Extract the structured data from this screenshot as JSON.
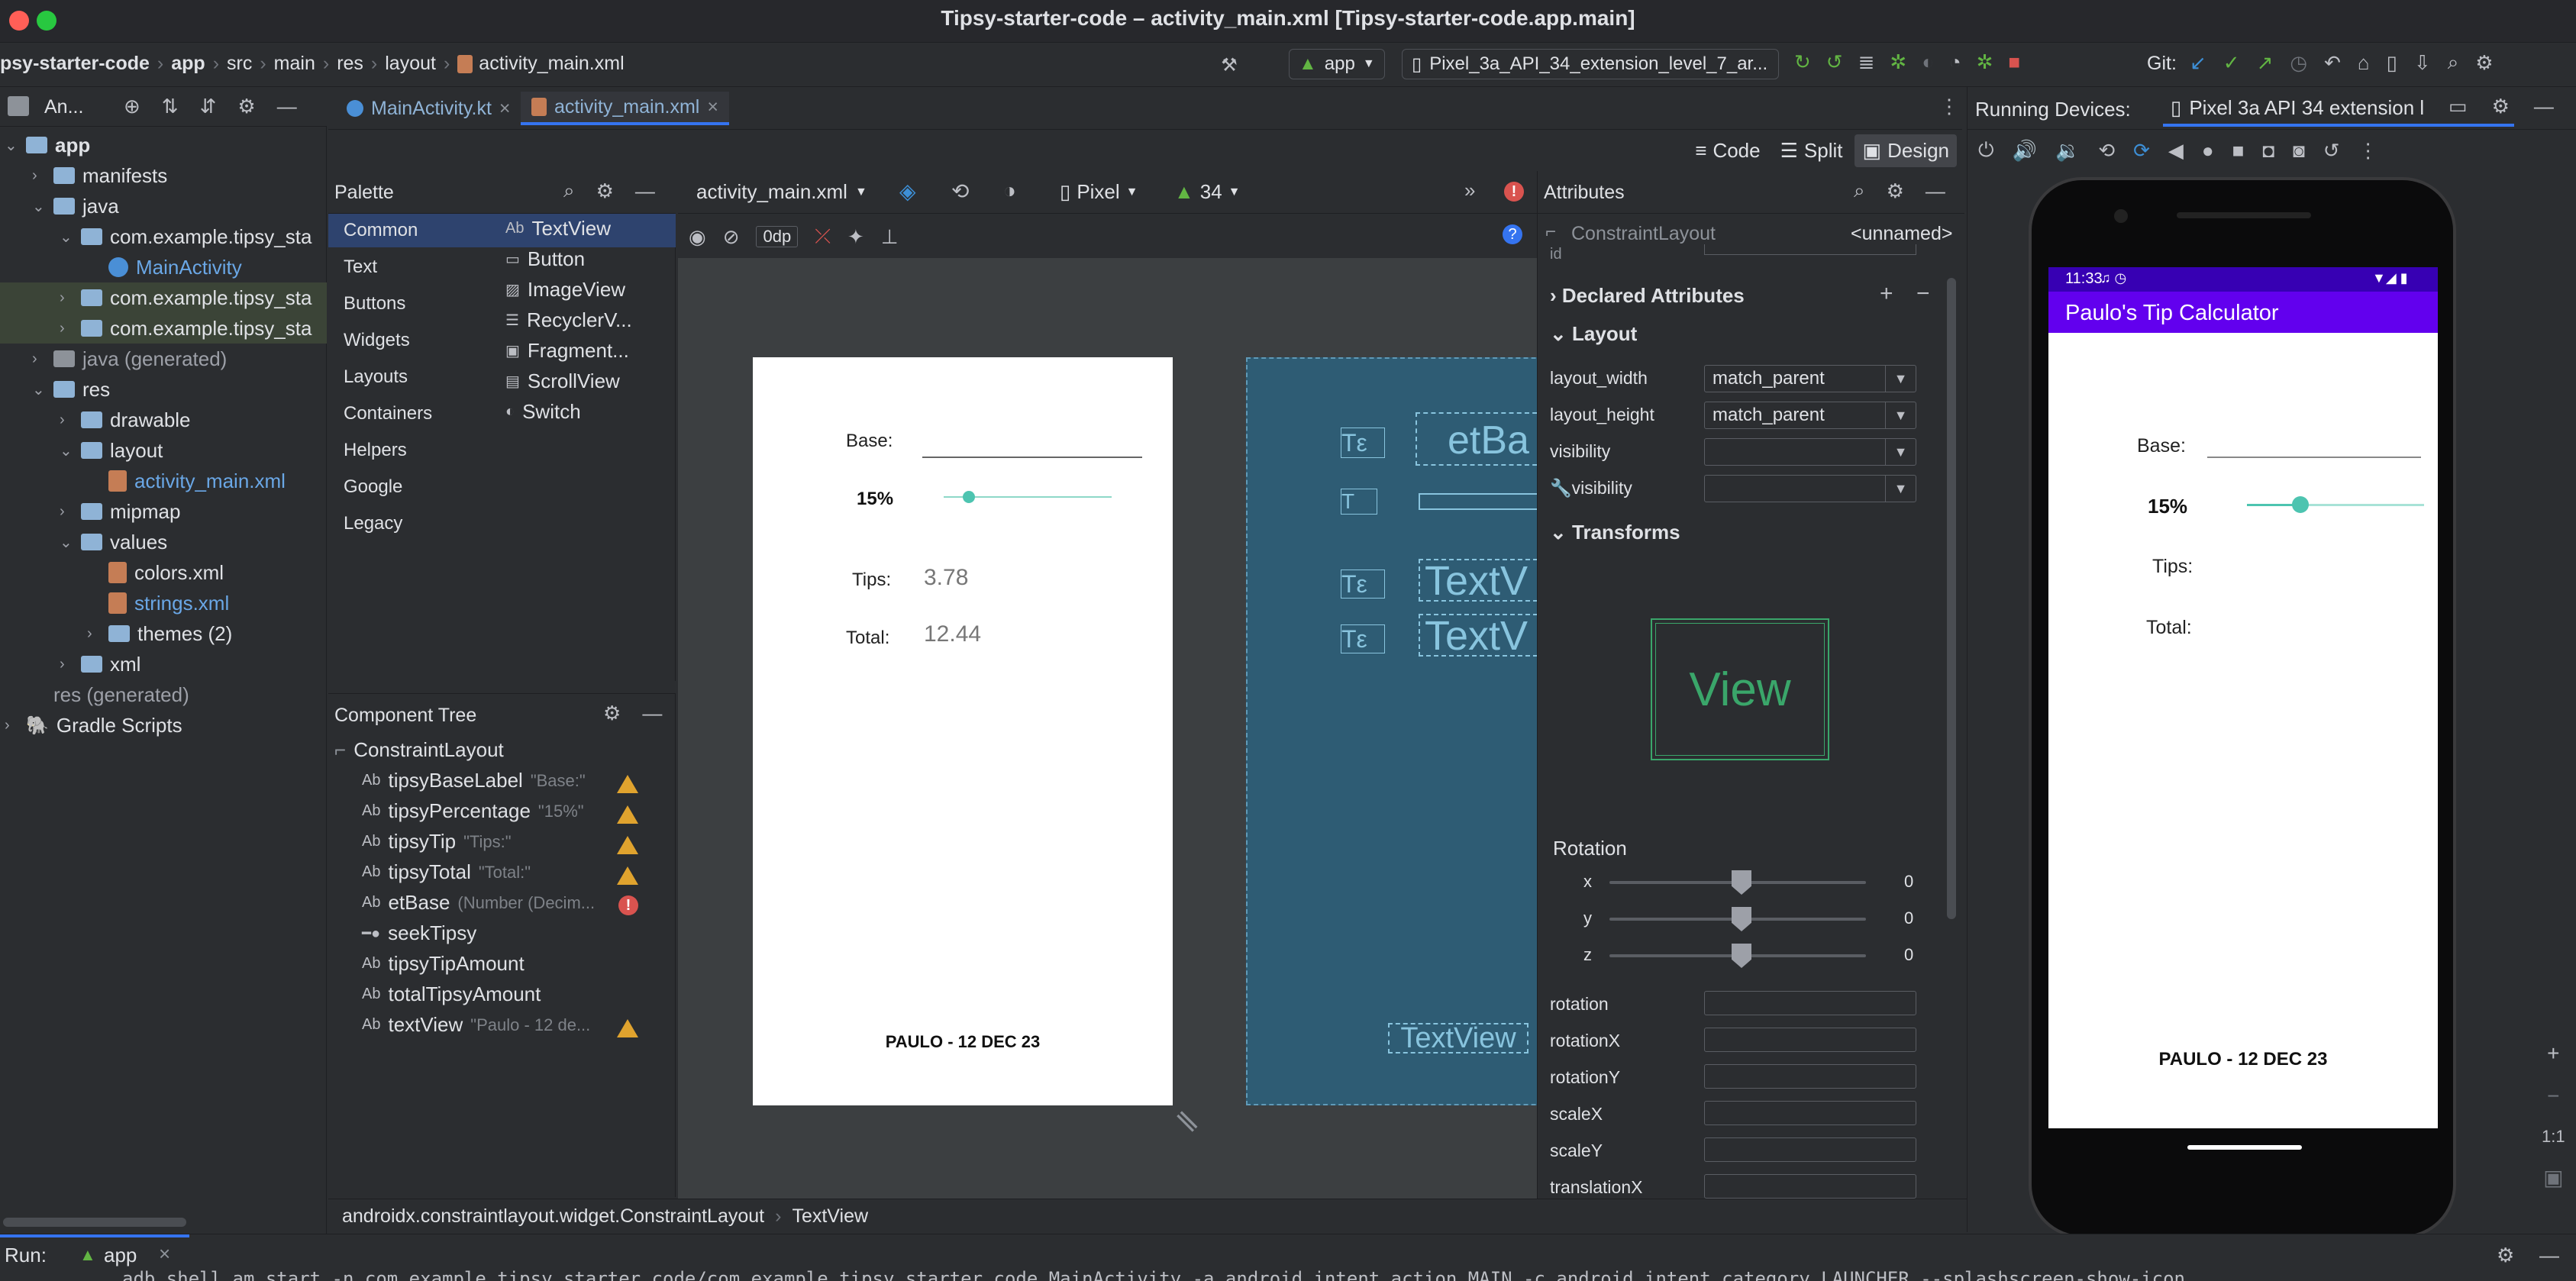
{
  "window": {
    "title": "Tipsy-starter-code – activity_main.xml [Tipsy-starter-code.app.main]"
  },
  "breadcrumb": [
    "psy-starter-code",
    "app",
    "src",
    "main",
    "res",
    "layout",
    "activity_main.xml"
  ],
  "toolbar": {
    "run_config": "app",
    "device": "Pixel_3a_API_34_extension_level_7_ar...",
    "git_label": "Git:"
  },
  "project": {
    "title": "An...",
    "tree": [
      {
        "label": "app",
        "depth": 0,
        "open": true,
        "kind": "folder",
        "bold": true
      },
      {
        "label": "manifests",
        "depth": 1,
        "open": false,
        "kind": "folder"
      },
      {
        "label": "java",
        "depth": 1,
        "open": true,
        "kind": "folder"
      },
      {
        "label": "com.example.tipsy_sta",
        "depth": 2,
        "open": true,
        "kind": "pkg"
      },
      {
        "label": "MainActivity",
        "depth": 3,
        "kind": "kt",
        "blue": true
      },
      {
        "label": "com.example.tipsy_sta",
        "depth": 2,
        "open": false,
        "kind": "pkg",
        "hl": true
      },
      {
        "label": "com.example.tipsy_sta",
        "depth": 2,
        "open": false,
        "kind": "pkg",
        "hl": true
      },
      {
        "label": "java (generated)",
        "depth": 1,
        "open": false,
        "kind": "folder",
        "dim": true
      },
      {
        "label": "res",
        "depth": 1,
        "open": true,
        "kind": "folder"
      },
      {
        "label": "drawable",
        "depth": 2,
        "open": false,
        "kind": "folder"
      },
      {
        "label": "layout",
        "depth": 2,
        "open": true,
        "kind": "folder"
      },
      {
        "label": "activity_main.xml",
        "depth": 3,
        "kind": "xml",
        "blue": true
      },
      {
        "label": "mipmap",
        "depth": 2,
        "open": false,
        "kind": "folder"
      },
      {
        "label": "values",
        "depth": 2,
        "open": true,
        "kind": "folder"
      },
      {
        "label": "colors.xml",
        "depth": 3,
        "kind": "xml"
      },
      {
        "label": "strings.xml",
        "depth": 3,
        "kind": "xml",
        "blue": true
      },
      {
        "label": "themes (2)",
        "depth": 3,
        "open": false,
        "kind": "folder"
      },
      {
        "label": "xml",
        "depth": 2,
        "open": false,
        "kind": "folder"
      },
      {
        "label": "res (generated)",
        "depth": 1,
        "kind": "plain",
        "dim": true
      },
      {
        "label": "Gradle Scripts",
        "depth": 0,
        "open": false,
        "kind": "gradle"
      }
    ]
  },
  "tabs": [
    {
      "label": "MainActivity.kt",
      "active": false
    },
    {
      "label": "activity_main.xml",
      "active": true
    }
  ],
  "view_modes": [
    "Code",
    "Split",
    "Design"
  ],
  "palette": {
    "title": "Palette",
    "categories": [
      "Common",
      "Text",
      "Buttons",
      "Widgets",
      "Layouts",
      "Containers",
      "Helpers",
      "Google",
      "Legacy"
    ],
    "items": [
      "TextView",
      "Button",
      "ImageView",
      "RecyclerV...",
      "Fragment...",
      "ScrollView",
      "Switch"
    ]
  },
  "component_tree": {
    "title": "Component Tree",
    "root": "ConstraintLayout",
    "nodes": [
      {
        "name": "tipsyBaseLabel",
        "hint": "\"Base:\"",
        "icon": "Ab",
        "warn": true
      },
      {
        "name": "tipsyPercentage",
        "hint": "\"15%\"",
        "icon": "Ab",
        "warn": true
      },
      {
        "name": "tipsyTip",
        "hint": "\"Tips:\"",
        "icon": "Ab",
        "warn": true
      },
      {
        "name": "tipsyTotal",
        "hint": "\"Total:\"",
        "icon": "Ab",
        "warn": true
      },
      {
        "name": "etBase",
        "hint": "(Number (Decim...",
        "icon": "Ab",
        "err": true
      },
      {
        "name": "seekTipsy",
        "hint": "",
        "icon": "seek"
      },
      {
        "name": "tipsyTipAmount",
        "hint": "",
        "icon": "Ab"
      },
      {
        "name": "totalTipsyAmount",
        "hint": "",
        "icon": "Ab"
      },
      {
        "name": "textView",
        "hint": "\"Paulo - 12 de...",
        "icon": "Ab",
        "warn": true
      }
    ]
  },
  "design_toolbar": {
    "file": "activity_main.xml",
    "device": "Pixel",
    "api": "34",
    "margin": "0dp"
  },
  "preview": {
    "base_label": "Base:",
    "percent": "15%",
    "tips_label": "Tips:",
    "tips_value": "3.78",
    "total_label": "Total:",
    "total_value": "12.44",
    "footer": "PAULO - 12 DEC 23",
    "slider_value": 0.15
  },
  "blueprint": {
    "labels": [
      "etBa",
      "TextV",
      "TextV",
      "TextView"
    ]
  },
  "attributes": {
    "title": "Attributes",
    "component": "ConstraintLayout",
    "component_id": "<unnamed>",
    "sections": {
      "declared": "Declared Attributes",
      "layout": "Layout",
      "transforms": "Transforms"
    },
    "layout_rows": [
      {
        "label": "layout_width",
        "value": "match_parent"
      },
      {
        "label": "layout_height",
        "value": "match_parent"
      },
      {
        "label": "visibility",
        "value": ""
      },
      {
        "label": "visibility",
        "value": ""
      }
    ],
    "view_preview": "View",
    "rotation_title": "Rotation",
    "rotation_axes": [
      {
        "axis": "x",
        "value": "0"
      },
      {
        "axis": "y",
        "value": "0"
      },
      {
        "axis": "z",
        "value": "0"
      }
    ],
    "fields": [
      "rotation",
      "rotationX",
      "rotationY",
      "scaleX",
      "scaleY",
      "translationX"
    ]
  },
  "running_devices": {
    "title": "Running Devices:",
    "device_tab": "Pixel 3a API 34 extension l",
    "phone": {
      "time": "11:33",
      "app_title": "Paulo's Tip Calculator",
      "base_label": "Base:",
      "percent": "15%",
      "tips_label": "Tips:",
      "total_label": "Total:",
      "footer": "PAULO - 12 DEC 23",
      "slider_value": 0.3
    },
    "zoom_label": "1:1"
  },
  "status_bar": {
    "crumb1": "androidx.constraintlayout.widget.ConstraintLayout",
    "crumb2": "TextView"
  },
  "run_bar": {
    "label": "Run:",
    "config": "app",
    "console": "adb shell am start -n com.example.tipsy_starter_code/com.example.tipsy_starter_code.MainActivity -a android.intent.action.MAIN -c android.intent.category.LAUNCHER --splashscreen-show-icon"
  },
  "colors": {
    "accent": "#3574f0",
    "purple": "#6200ee",
    "teal": "#4dc4b0",
    "warn": "#e0a32e",
    "error": "#d9534f"
  }
}
